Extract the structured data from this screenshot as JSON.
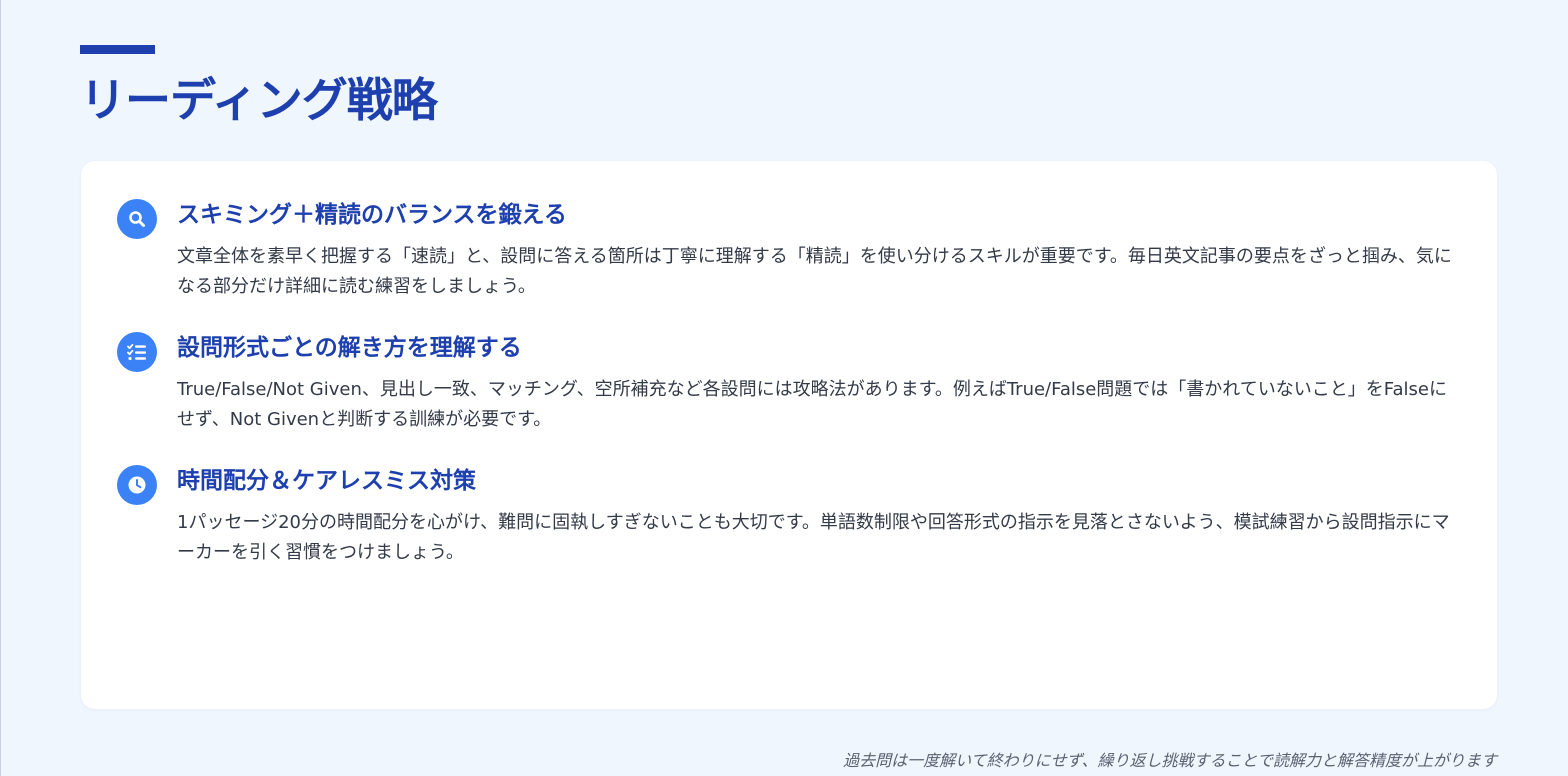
{
  "page": {
    "title": "リーディング戦略",
    "footer_note": "過去問は一度解いて終わりにせず、繰り返し挑戦することで読解力と解答精度が上がります"
  },
  "colors": {
    "accent": "#1e40af",
    "icon_bg": "#3b82f6",
    "page_bg": "#f0f6fe",
    "card_bg": "#ffffff",
    "body_text": "#333a48"
  },
  "strategies": [
    {
      "icon": "search-icon",
      "heading": "スキミング＋精読のバランスを鍛える",
      "body": "文章全体を素早く把握する「速読」と、設問に答える箇所は丁寧に理解する「精読」を使い分けるスキルが重要です。毎日英文記事の要点をざっと掴み、気になる部分だけ詳細に読む練習をしましょう。"
    },
    {
      "icon": "checklist-icon",
      "heading": "設問形式ごとの解き方を理解する",
      "body": "True/False/Not Given、見出し一致、マッチング、空所補充など各設問には攻略法があります。例えばTrue/False問題では「書かれていないこと」をFalseにせず、Not Givenと判断する訓練が必要です。"
    },
    {
      "icon": "clock-icon",
      "heading": "時間配分＆ケアレスミス対策",
      "body": "1パッセージ20分の時間配分を心がけ、難問に固執しすぎないことも大切です。単語数制限や回答形式の指示を見落とさないよう、模試練習から設問指示にマーカーを引く習慣をつけましょう。"
    }
  ]
}
